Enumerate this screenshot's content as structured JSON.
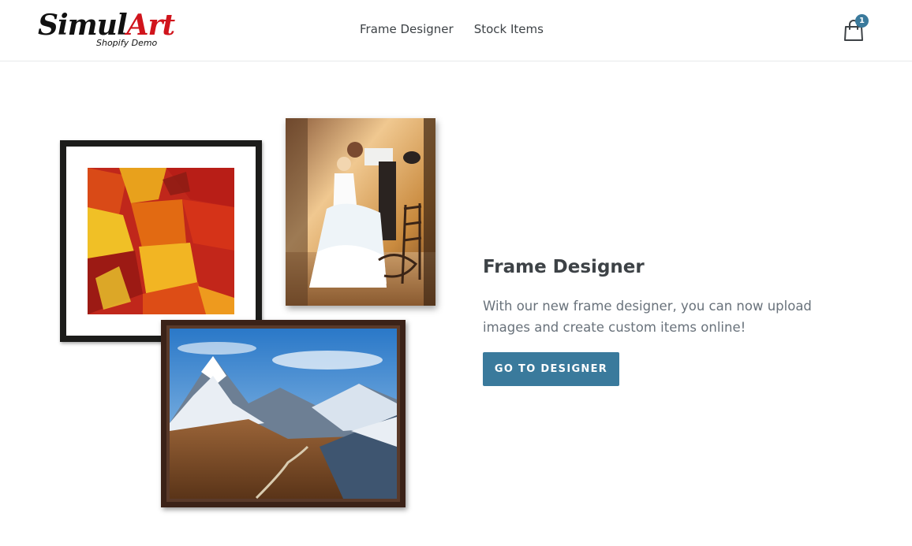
{
  "header": {
    "logo": {
      "main_part1": "Simul",
      "main_part2": "Art",
      "subtitle": "Shopify Demo"
    },
    "nav": [
      {
        "label": "Frame Designer"
      },
      {
        "label": "Stock Items"
      }
    ],
    "cart": {
      "count": "1",
      "icon": "shopping-bag-icon"
    }
  },
  "feature": {
    "title": "Frame Designer",
    "text": "With our new frame designer, you can now upload images and create custom items online!",
    "button_label": "GO TO DESIGNER"
  },
  "colors": {
    "accent": "#3a7a9c",
    "logo_red": "#d0141c",
    "text_dark": "#3d4246",
    "text_muted": "#69727b"
  }
}
